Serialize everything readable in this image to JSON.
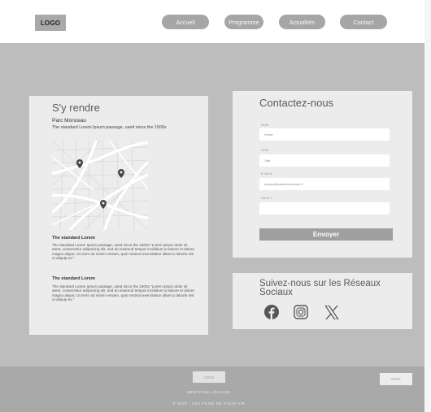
{
  "header": {
    "logo": "LOGO",
    "nav": [
      "Accueil",
      "Programme",
      "Actualités",
      "Contact"
    ]
  },
  "location": {
    "title": "S'y rendre",
    "place": "Parc Monceau",
    "intro": "The standard Lorem Ipsum passage, used since the 1500s",
    "blocks": [
      {
        "heading": "The standard Lorem",
        "body": "The standard Lorem Ipsum passage, used since the 1500s \"Lorem ipsum dolor sit amet, consectetur adipiscing elit, sed do eiusmod tempor incididunt ut labore et dolore magna aliqua. Ut enim ad minim veniam, quis nostrud exercitation ullamco laboris nisi ut aliquip ex.\""
      },
      {
        "heading": "The standard Lorem",
        "body": "The standard Lorem Ipsum passage, used since the 1500s \"Lorem ipsum dolor sit amet, consectetur adipiscing elit, sed do eiusmod tempor incididunt ut labore et dolore magna aliqua. Ut enim ad minim veniam, quis nostrud exercitation ullamco laboris nisi ut aliquip ex.\""
      }
    ]
  },
  "contact": {
    "title": "Contactez-nous",
    "fields": [
      {
        "label": "NOM",
        "value": "Homer"
      },
      {
        "label": "NOM",
        "value": "Julie"
      },
      {
        "label": "E-MAIL",
        "value": "bonjour@unsiteavecunnom.fr"
      },
      {
        "label": "OBJET",
        "value": ""
      }
    ],
    "submit": "Envoyer"
  },
  "social": {
    "title": "Suivez-nous sur les Réseaux Sociaux",
    "icons": [
      "facebook-icon",
      "instagram-icon",
      "x-icon"
    ]
  },
  "footer": {
    "logo": "LOGO",
    "legal": "MENTIONS LÉGALES",
    "copyright": "© 2020 · LES FILMS DE PLEIN AIR",
    "button": "MISC"
  },
  "colors": {
    "page_bg": "#bdbdbd",
    "card_bg": "#ececec",
    "button": "#a6a6a6",
    "footer": "#a9a9a9"
  }
}
